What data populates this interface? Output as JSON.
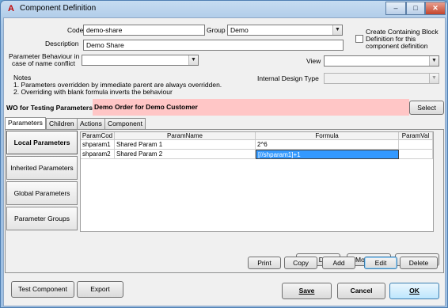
{
  "window": {
    "title": "Component Definition"
  },
  "form": {
    "code_label": "Code",
    "code_value": "demo-share",
    "group_label": "Group",
    "group_value": "Demo",
    "description_label": "Description",
    "description_value": "Demo Share",
    "param_behaviour_label_line1": "Parameter Behaviour in",
    "param_behaviour_label_line2": "case of name conflict",
    "param_behaviour_value": "",
    "view_label": "View",
    "view_value": "",
    "create_block_line1": "Create Containing Block",
    "create_block_line2": "Definition for this",
    "create_block_line3": "component definition",
    "internal_design_label": "Internal Design Type",
    "internal_design_value": "",
    "notes_title": "Notes",
    "note1": "1. Parameters overridden by immediate parent are always overridden.",
    "note2": "2. Overriding with blank formula inverts the behaviour"
  },
  "wo": {
    "label": "WO for Testing Parameters:",
    "value": "Demo Order for Demo Customer",
    "select_label": "Select"
  },
  "tabs": [
    "Parameters",
    "Children",
    "Actions",
    "Component"
  ],
  "side": [
    "Local Parameters",
    "Inherited Parameters",
    "Global Parameters",
    "Parameter Groups"
  ],
  "grid": {
    "headers": [
      "ParamCod",
      "ParamName",
      "Formula",
      "ParamVal"
    ],
    "rows": [
      [
        "shparam1",
        "Shared Param 1",
        "2^6",
        ""
      ],
      [
        "shparam2",
        "Shared Param 2",
        "[//shparam1]+1",
        ""
      ]
    ]
  },
  "buttons": {
    "move_down": "Move Down",
    "move_up": "Move Up",
    "renumber": "Renumber",
    "print": "Print",
    "copy": "Copy",
    "add": "Add",
    "edit": "Edit",
    "delete": "Delete",
    "test_component": "Test Component",
    "export": "Export",
    "save": "Save",
    "cancel": "Cancel",
    "ok": "OK"
  },
  "colors": {
    "wo_highlight": "#ffc6c6",
    "selection": "#3399ff",
    "frame": "#9fc0e3"
  }
}
